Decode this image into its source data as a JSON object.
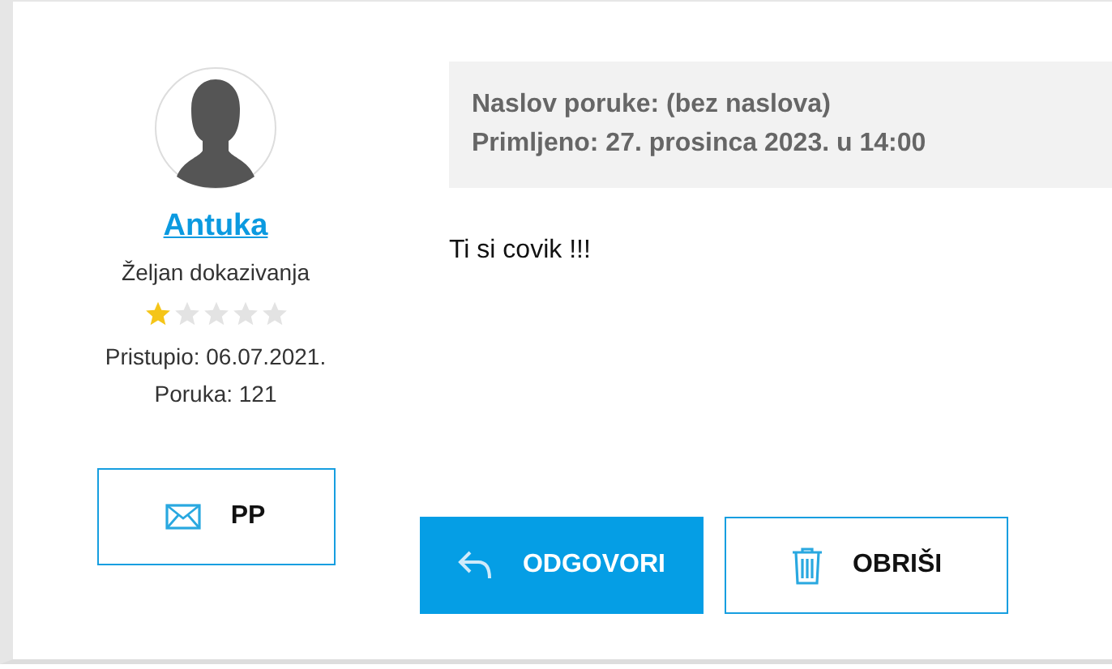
{
  "author": {
    "name": "Antuka",
    "rank": "Željan dokazivanja",
    "stars": 1,
    "joined": "Pristupio: 06.07.2021.",
    "posts": "Poruka: 121"
  },
  "pm_button": {
    "label": "PP"
  },
  "message": {
    "subject": "Naslov poruke: (bez naslova)",
    "received": "Primljeno: 27. prosinca 2023. u 14:00",
    "body": "Ti si covik !!!"
  },
  "actions": [
    {
      "label": "ODGOVORI",
      "kind": "primary"
    },
    {
      "label": "OBRIŠI",
      "kind": "outline"
    }
  ]
}
